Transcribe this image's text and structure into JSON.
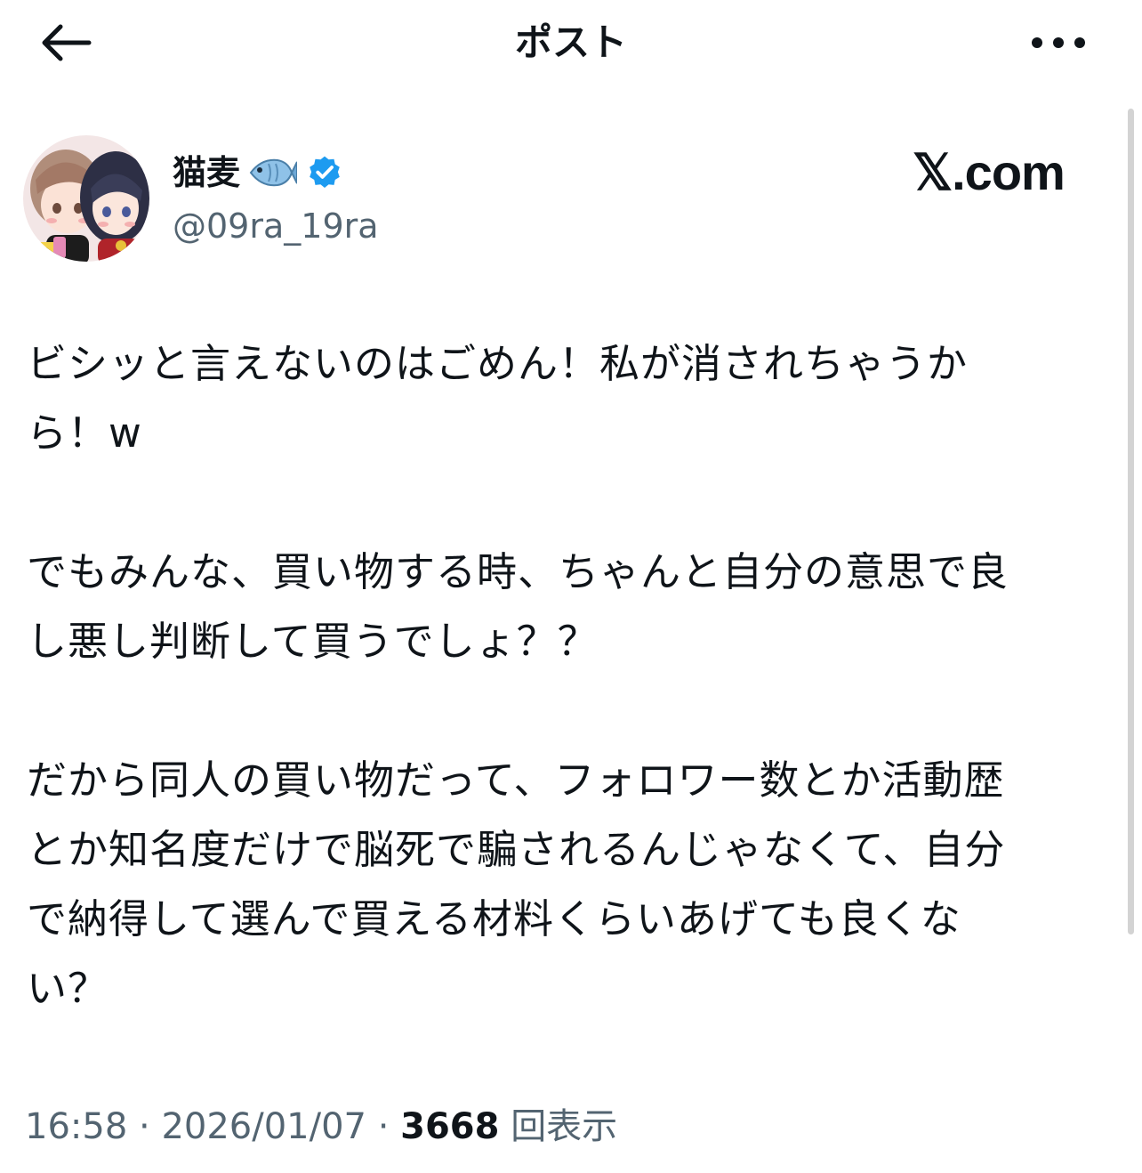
{
  "header": {
    "title": "ポスト",
    "back_icon": "arrow-left-icon",
    "more_icon": "more-horizontal-icon"
  },
  "author": {
    "display_name": "猫麦",
    "emoji_icon": "fish-icon",
    "verified_icon": "verified-badge-icon",
    "handle": "@09ra_19ra"
  },
  "brand": {
    "logo_text": "𝕏.com"
  },
  "post": {
    "paragraphs": [
      {
        "lines": [
          "ビシッと言えないのはごめん！私が消されちゃうか",
          "ら！w"
        ]
      },
      {
        "lines": [
          "でもみんな、買い物する時、ちゃんと自分の意思で良",
          "し悪し判断して買うでしょ？？"
        ]
      },
      {
        "lines": [
          "だから同人の買い物だって、フォロワー数とか活動歴",
          "とか知名度だけで脳死で騙されるんじゃなくて、自分",
          "で納得して選んで買える材料くらいあげても良くな",
          "い？"
        ]
      }
    ]
  },
  "meta": {
    "time": "16:58",
    "separator": " · ",
    "date": "2026/01/07",
    "views_count": "3668",
    "views_label": "回表示"
  },
  "colors": {
    "text_primary": "#0f1419",
    "text_secondary": "#536471",
    "verified_blue": "#1d9bf0",
    "background": "#ffffff"
  }
}
